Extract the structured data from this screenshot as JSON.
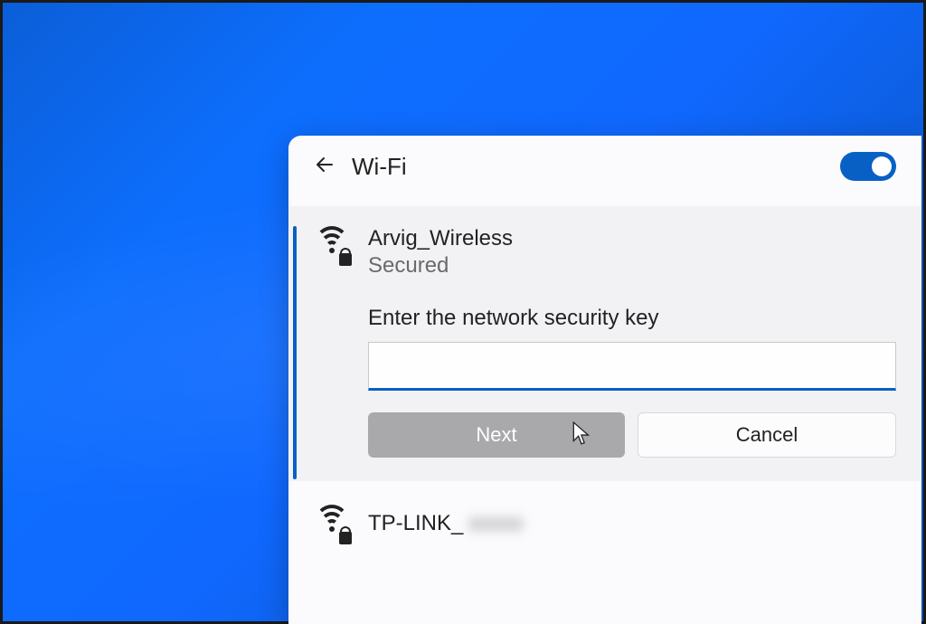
{
  "header": {
    "title": "Wi-Fi",
    "toggle_on": true
  },
  "selected_network": {
    "name": "Arvig_Wireless",
    "status": "Secured",
    "prompt": "Enter the network security key",
    "password_value": "",
    "next_label": "Next",
    "cancel_label": "Cancel"
  },
  "other_networks": [
    {
      "name": "TP-LINK_",
      "hidden_suffix": "xxxxx"
    }
  ],
  "icons": {
    "back": "back-arrow-icon",
    "wifi_secured": "wifi-secured-icon",
    "toggle": "wifi-toggle"
  },
  "colors": {
    "accent": "#0860c4",
    "panel_bg": "#fbfbfd",
    "expanded_bg": "#f2f2f5",
    "disabled_btn": "#a9a8ab"
  }
}
